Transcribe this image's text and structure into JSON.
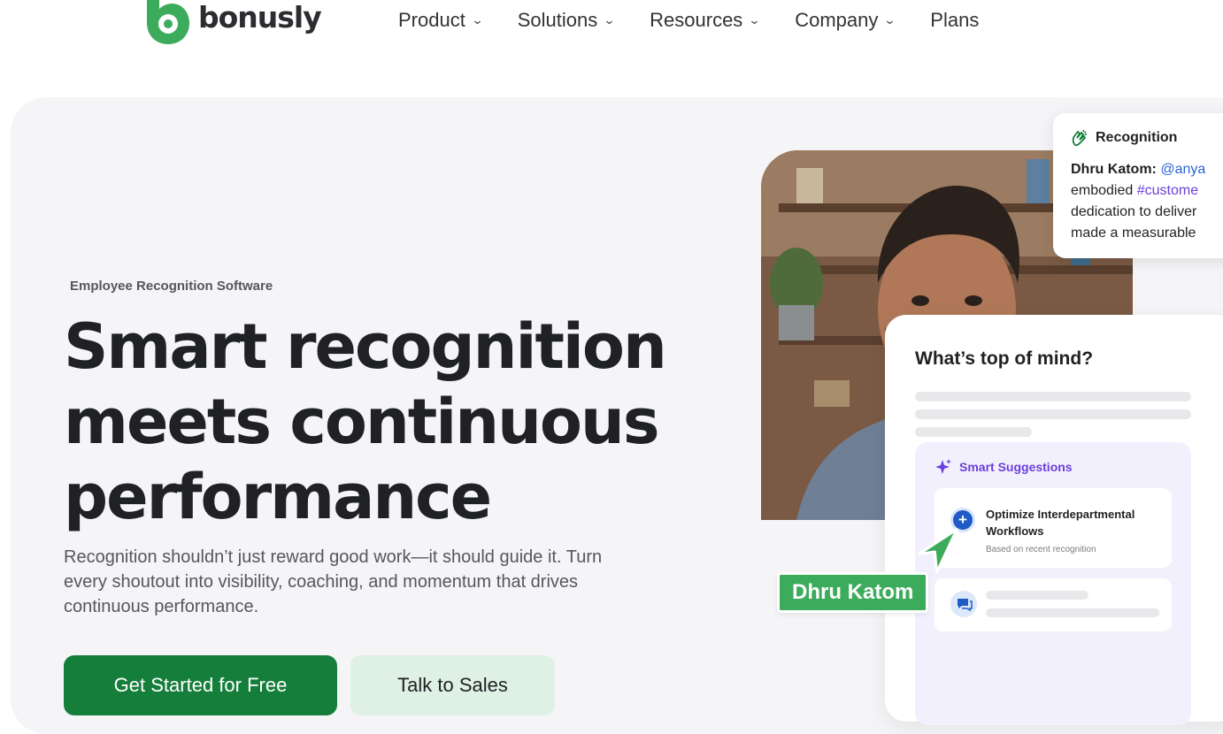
{
  "brand": {
    "name": "bonusly",
    "color": "#3cab5b"
  },
  "nav": {
    "items": [
      {
        "label": "Product",
        "has_dropdown": true
      },
      {
        "label": "Solutions",
        "has_dropdown": true
      },
      {
        "label": "Resources",
        "has_dropdown": true
      },
      {
        "label": "Company",
        "has_dropdown": true
      },
      {
        "label": "Plans",
        "has_dropdown": false
      }
    ],
    "dropdown_icon": "chevron-down-icon"
  },
  "hero": {
    "eyebrow": "Employee Recognition Software",
    "headline_lines": [
      "Smart recognition",
      "meets continuous",
      "performance"
    ],
    "subcopy": "Recognition shouldn’t just reward good work—it should guide it. Turn every shoutout into visibility, coaching, and momentum that drives continuous performance.",
    "primary_cta": "Get Started for Free",
    "secondary_cta": "Talk to Sales",
    "colors": {
      "primary": "#167e3b",
      "secondary_bg": "#dff0e4",
      "background": "#f5f5f7"
    }
  },
  "recognition_card": {
    "icon": "clapping-hands-icon",
    "title": "Recognition",
    "author": "Dhru Katom:",
    "mention": "@anya",
    "line2_prefix": "embodied ",
    "hashtag": "#custome",
    "line3": "dedication to deliver",
    "line4": "made a measurable"
  },
  "mind_card": {
    "title": "What’s top of mind?",
    "suggestions_header": "Smart Suggestions",
    "suggestions_icon": "sparkle-icon",
    "suggestion_title": "Optimize Interdepartmental Workflows",
    "suggestion_sub": "Based on recent recognition",
    "suggestion_icon": "plus-circle-icon",
    "second_icon": "chat-bubble-icon"
  },
  "name_tag": "Dhru Katom"
}
